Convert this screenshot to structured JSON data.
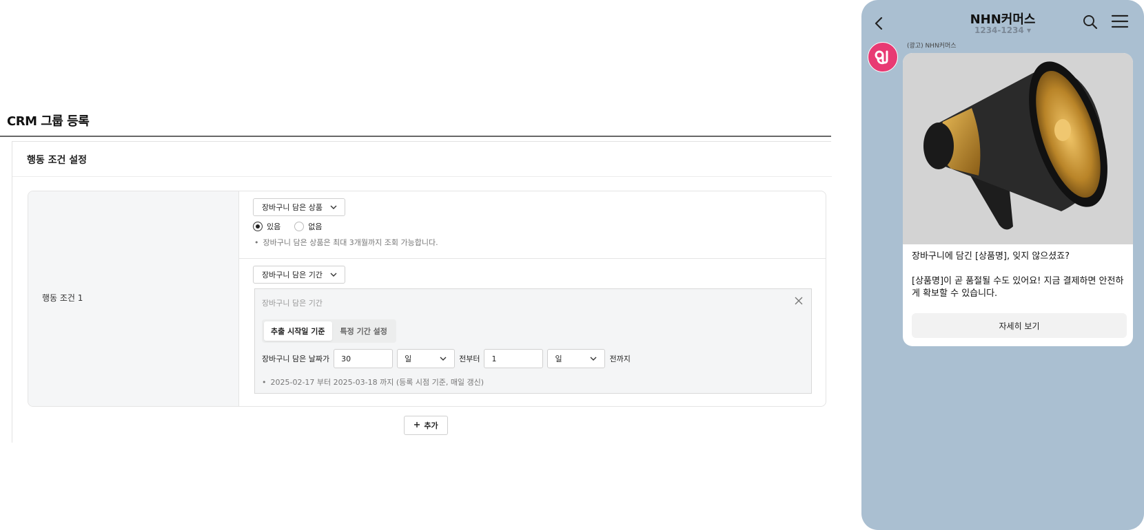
{
  "page": {
    "title": "CRM 그룹 등록"
  },
  "section": {
    "title": "행동 조건 설정"
  },
  "condition": {
    "label": "행동 조건 1",
    "cart_product": {
      "select_label": "장바구니 담은 상품",
      "radio_yes": "있음",
      "radio_no": "없음",
      "selected": "있음",
      "note": "장바구니 담은 상품은 최대 3개월까지 조회 가능합니다."
    },
    "cart_period": {
      "select_label": "장바구니 담은 기간",
      "panel_title": "장바구니 담은 기간",
      "tab_extract": "추출 시작일 기준",
      "tab_specific": "특정 기간 설정",
      "active_tab": "추출 시작일 기준",
      "range_prefix": "장바구니 담은 날짜가",
      "from_value": "30",
      "from_unit": "일",
      "from_suffix": "전부터",
      "to_value": "1",
      "to_unit": "일",
      "to_suffix": "전까지",
      "note": "2025-02-17 부터 2025-03-18 까지 (등록 시점 기준, 매일 갱신)"
    }
  },
  "add_button": {
    "label": "추가"
  },
  "phone": {
    "channel_name": "NHN커머스",
    "channel_number": "1234-1234 ▾",
    "sender_label": "(광고) NHN커머스",
    "message_line1": " 장바구니에 담긴 [상품명], 잊지 않으셨죠?",
    "message_line2": "[상품명]이 곧 품절될 수도 있어요! 지금 결제하면 안전하게 확보할 수 있습니다.",
    "detail_button": "자세히 보기",
    "avatar_color": "#e83a73",
    "background_color": "#aabfd1"
  },
  "icons": [
    "chevron-down-icon",
    "close-icon",
    "plus-icon",
    "back-icon",
    "search-icon",
    "menu-icon",
    "megaphone-image"
  ]
}
